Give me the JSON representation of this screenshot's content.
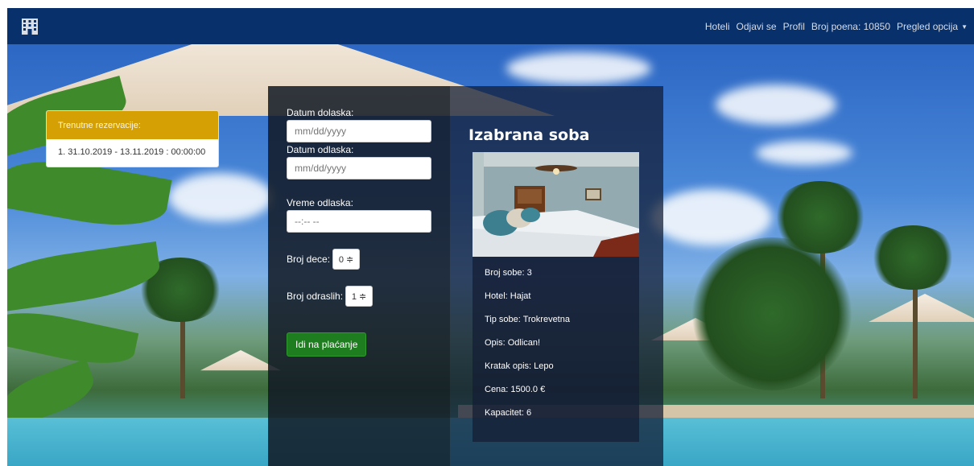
{
  "nav": {
    "links": [
      {
        "label": "Hoteli"
      },
      {
        "label": "Odjavi se"
      },
      {
        "label": "Profil"
      },
      {
        "label": "Broj poena: 10850"
      },
      {
        "label": "Pregled opcija"
      }
    ],
    "brand_icon": "hotel-building-icon"
  },
  "reservations": {
    "header": "Trenutne rezervacije:",
    "items": [
      "1. 31.10.2019 - 13.11.2019 : 00:00:00"
    ]
  },
  "form": {
    "arrival_label": "Datum dolaska:",
    "arrival_placeholder": "mm/dd/yyyy",
    "departure_label": "Datum odlaska:",
    "departure_placeholder": "mm/dd/yyyy",
    "time_label": "Vreme odlaska:",
    "time_placeholder": "--:-- --",
    "children_label": "Broj dece:",
    "children_value": "0 ≑",
    "adults_label": "Broj odraslih:",
    "adults_value": "1 ≑",
    "submit_label": "Idi na plaćanje"
  },
  "room": {
    "title": "Izabrana soba",
    "details": [
      "Broj sobe: 3",
      "Hotel: Hajat",
      "Tip sobe: Trokrevetna",
      "Opis: Odlican!",
      "Kratak opis: Lepo",
      "Cena: 1500.0 €",
      "Kapacitet: 6"
    ]
  },
  "colors": {
    "navbar": "#08306b",
    "reservations_header": "#d4a004",
    "pay_button": "#1e7d1e"
  }
}
